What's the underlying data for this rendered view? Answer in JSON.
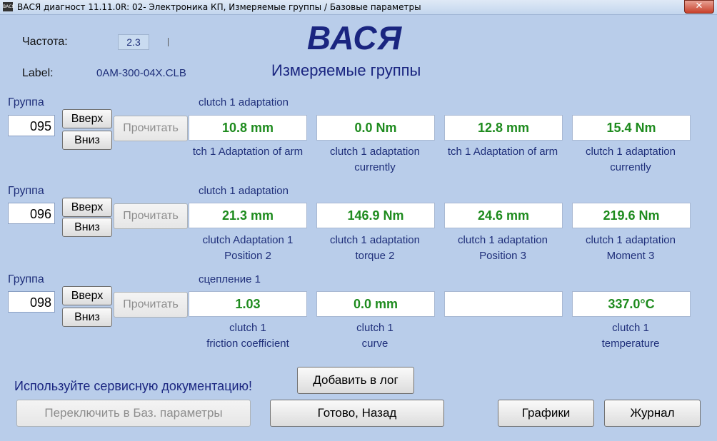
{
  "window": {
    "title": "ВАСЯ диагност 11.11.0R: 02- Электроника КП,  Измеряемые группы / Базовые параметры",
    "app_icon": "ВАСЯ",
    "close_glyph": "✕"
  },
  "header": {
    "freq_label": "Частота:",
    "freq_value": "2.3",
    "label_label": "Label:",
    "label_value": "0AM-300-04X.CLB",
    "brand": "ВАСЯ",
    "subtitle": "Измеряемые группы"
  },
  "groups": [
    {
      "label": "Группа",
      "number": "095",
      "up": "Вверх",
      "down": "Вниз",
      "read": "Прочитать",
      "title": "clutch 1 adaptation",
      "values": [
        "10.8 mm",
        "0.0 Nm",
        "12.8 mm",
        "15.4 Nm"
      ],
      "captions": [
        [
          "tch 1 Adaptation of arm",
          ""
        ],
        [
          "clutch 1 adaptation",
          "currently"
        ],
        [
          "tch 1 Adaptation of arm",
          ""
        ],
        [
          "clutch 1 adaptation",
          "currently"
        ]
      ]
    },
    {
      "label": "Группа",
      "number": "096",
      "up": "Вверх",
      "down": "Вниз",
      "read": "Прочитать",
      "title": "clutch 1 adaptation",
      "values": [
        "21.3 mm",
        "146.9 Nm",
        "24.6 mm",
        "219.6 Nm"
      ],
      "captions": [
        [
          "clutch Adaptation 1",
          "Position 2"
        ],
        [
          "clutch 1 adaptation",
          "torque 2"
        ],
        [
          "clutch 1 adaptation",
          "Position 3"
        ],
        [
          "clutch 1 adaptation",
          "Moment 3"
        ]
      ]
    },
    {
      "label": "Группа",
      "number": "098",
      "up": "Вверх",
      "down": "Вниз",
      "read": "Прочитать",
      "title": "сцепление 1",
      "values": [
        "1.03",
        "0.0 mm",
        "",
        "337.0°C"
      ],
      "captions": [
        [
          "clutch 1",
          "friction coefficient"
        ],
        [
          "clutch 1",
          "curve"
        ],
        [
          "",
          ""
        ],
        [
          "clutch 1",
          "temperature"
        ]
      ]
    }
  ],
  "footer": {
    "note": "Используйте сервисную документацию!",
    "add_log": "Добавить в лог",
    "switch_basic": "Переключить в Баз. параметры",
    "done_back": "Готово, Назад",
    "charts": "Графики",
    "journal": "Журнал"
  }
}
